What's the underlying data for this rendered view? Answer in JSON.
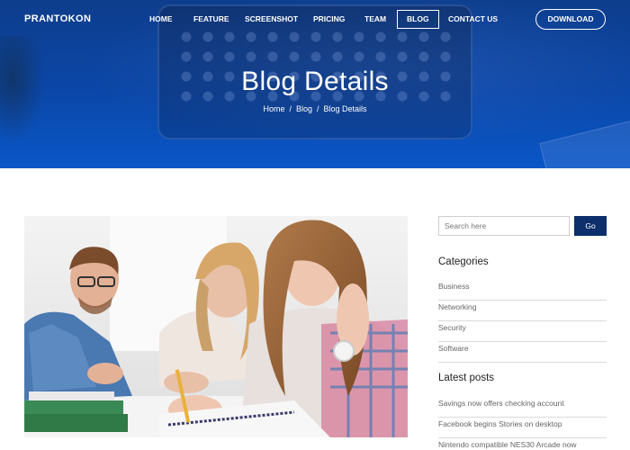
{
  "brand": "PRANTOKON",
  "nav": {
    "items": [
      {
        "label": "HOME"
      },
      {
        "label": "FEATURE"
      },
      {
        "label": "SCREENSHOT"
      },
      {
        "label": "PRICING"
      },
      {
        "label": "TEAM"
      },
      {
        "label": "BLOG",
        "active": true
      },
      {
        "label": "CONTACT US"
      }
    ],
    "download_label": "DOWNLOAD"
  },
  "hero": {
    "title": "Blog Details",
    "breadcrumb": [
      "Home",
      "Blog",
      "Blog Details"
    ],
    "separator": "/"
  },
  "sidebar": {
    "search": {
      "placeholder": "Search here",
      "button_label": "Go"
    },
    "categories": {
      "title": "Categories",
      "items": [
        "Business",
        "Networking",
        "Security",
        "Software"
      ]
    },
    "latest_posts": {
      "title": "Latest posts",
      "items": [
        "Savings now offers checking account",
        "Facebook begins Stories on desktop",
        "Nintendo compatible NES30 Arcade now"
      ]
    }
  },
  "colors": {
    "accent": "#0a4fb5",
    "button_dark": "#0d2f6b"
  }
}
